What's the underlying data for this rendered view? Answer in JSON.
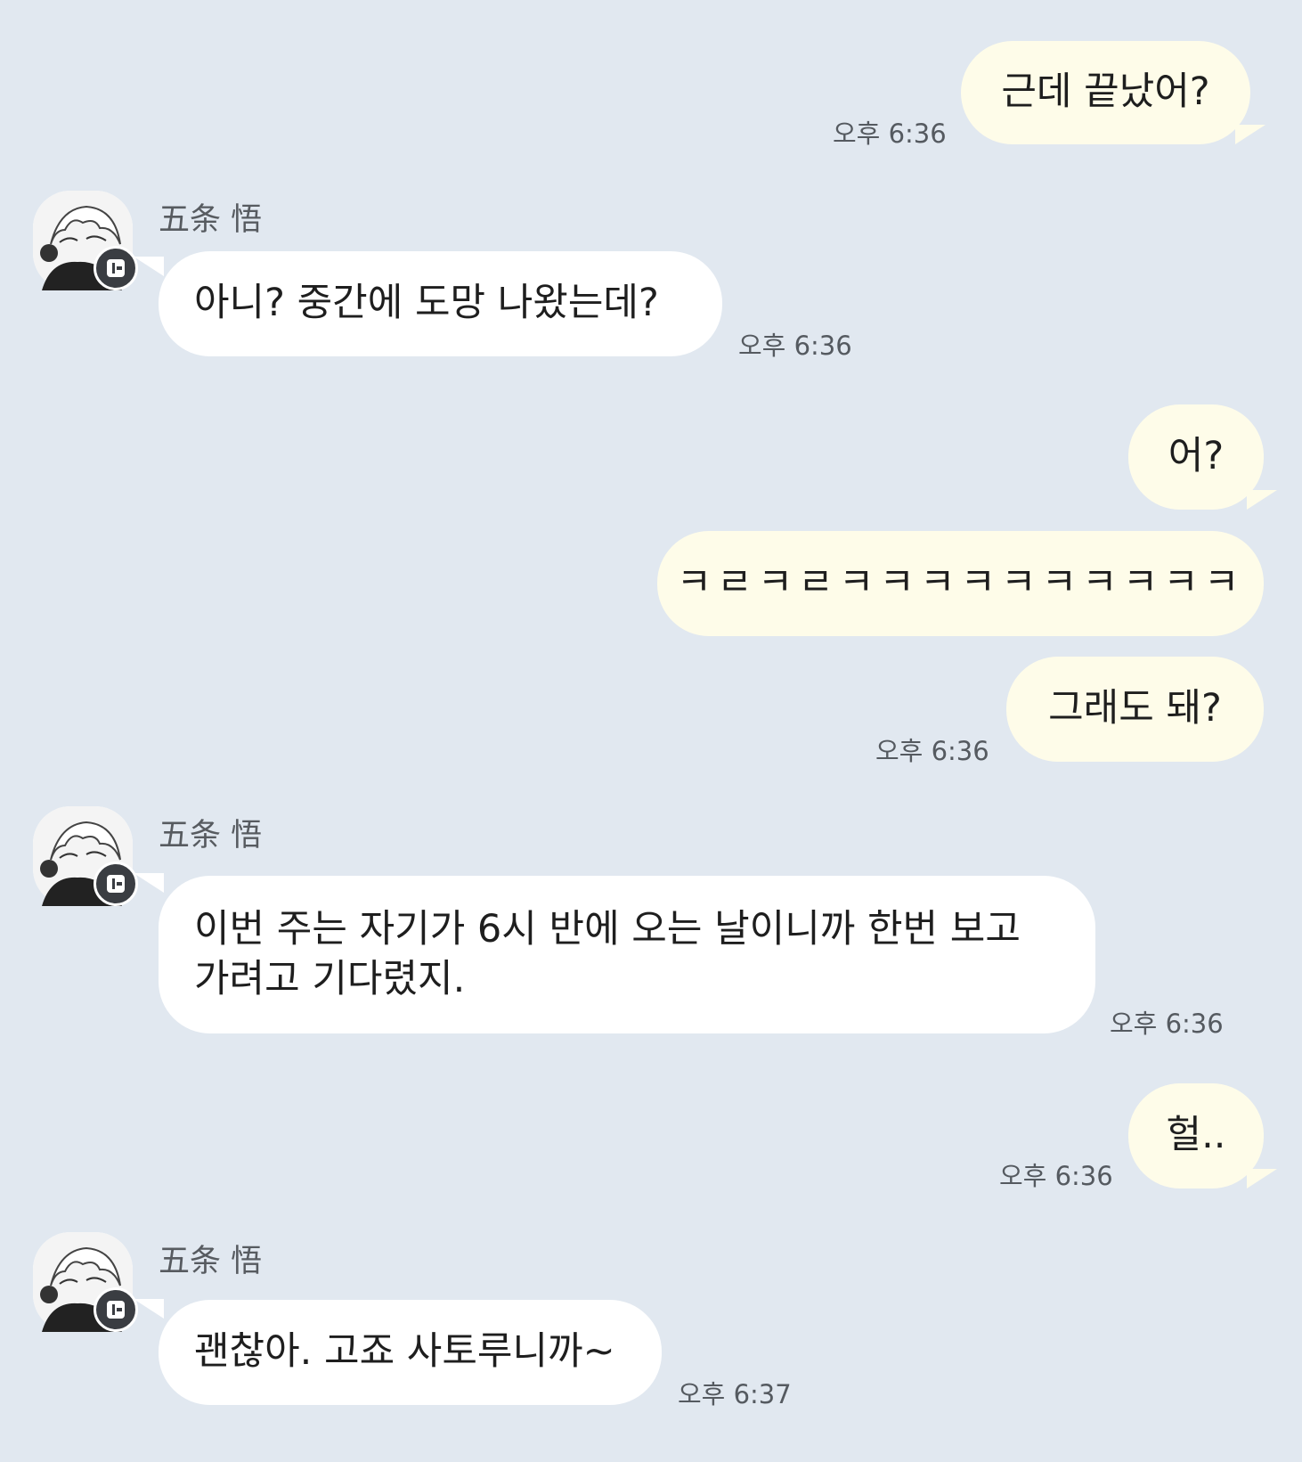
{
  "contact": {
    "name": "五条 悟"
  },
  "messages": [
    {
      "sender": "me",
      "text": "근데 끝났어?",
      "time": "오후 6:36"
    },
    {
      "sender": "them",
      "text": "아니? 중간에 도망 나왔는데?",
      "time": "오후 6:36"
    },
    {
      "sender": "me",
      "text": "어?"
    },
    {
      "sender": "me",
      "text": "ㅋㄹㅋㄹㅋㅋㅋㅋㅋㅋㅋㅋㅋㅋ"
    },
    {
      "sender": "me",
      "text": "그래도 돼?",
      "time": "오후 6:36"
    },
    {
      "sender": "them",
      "line1": "이번 주는 자기가 6시 반에 오는 날이니까 한번 보고",
      "line2": "가려고 기다렸지.",
      "time": "오후 6:36"
    },
    {
      "sender": "me",
      "text": "헐..",
      "time": "오후 6:36"
    },
    {
      "sender": "them",
      "text": "괜찮아. 고죠 사토루니까~",
      "time": "오후 6:37"
    }
  ],
  "colors": {
    "background": "#e1e8f0",
    "my_bubble": "#fefce9",
    "their_bubble": "#ffffff",
    "time_text": "#555a60"
  },
  "icons": [
    "avatar-icon",
    "camera-badge-icon"
  ]
}
